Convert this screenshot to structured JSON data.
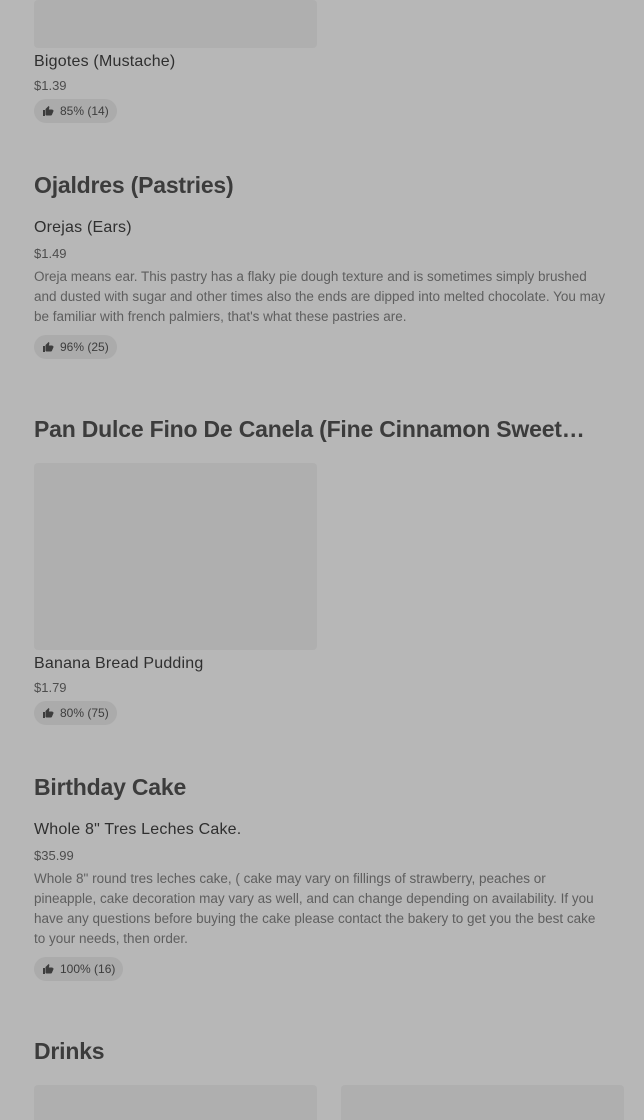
{
  "sections": [
    {
      "items": [
        {
          "name": "Bigotes (Mustache)",
          "price": "$1.39",
          "rating": "85% (14)"
        }
      ]
    },
    {
      "title": "Ojaldres (Pastries)",
      "items": [
        {
          "name": "Orejas (Ears)",
          "price": "$1.49",
          "description": "Oreja means ear. This pastry has a flaky pie dough texture and is sometimes simply brushed and dusted with sugar and other times also the ends are dipped into melted chocolate. You may be familiar with french palmiers, that's what these pastries are.",
          "rating": "96% (25)"
        }
      ]
    },
    {
      "title": "Pan Dulce Fino De Canela (Fine Cinnamon Sweet…",
      "items": [
        {
          "name": "Banana Bread Pudding",
          "price": "$1.79",
          "rating": "80% (75)"
        }
      ]
    },
    {
      "title": "Birthday Cake",
      "items": [
        {
          "name": "Whole 8\" Tres Leches Cake.",
          "price": "$35.99",
          "description": "Whole 8\" round tres leches cake, ( cake may vary on fillings of strawberry, peaches or pineapple, cake decoration may vary as well, and can change depending on availability. If you have any questions before buying the cake please contact the bakery to get you the best cake to your needs, then order.",
          "rating": "100% (16)"
        }
      ]
    },
    {
      "title": "Drinks",
      "items": []
    }
  ],
  "icons": {
    "rating": "thumbs-up-icon"
  }
}
